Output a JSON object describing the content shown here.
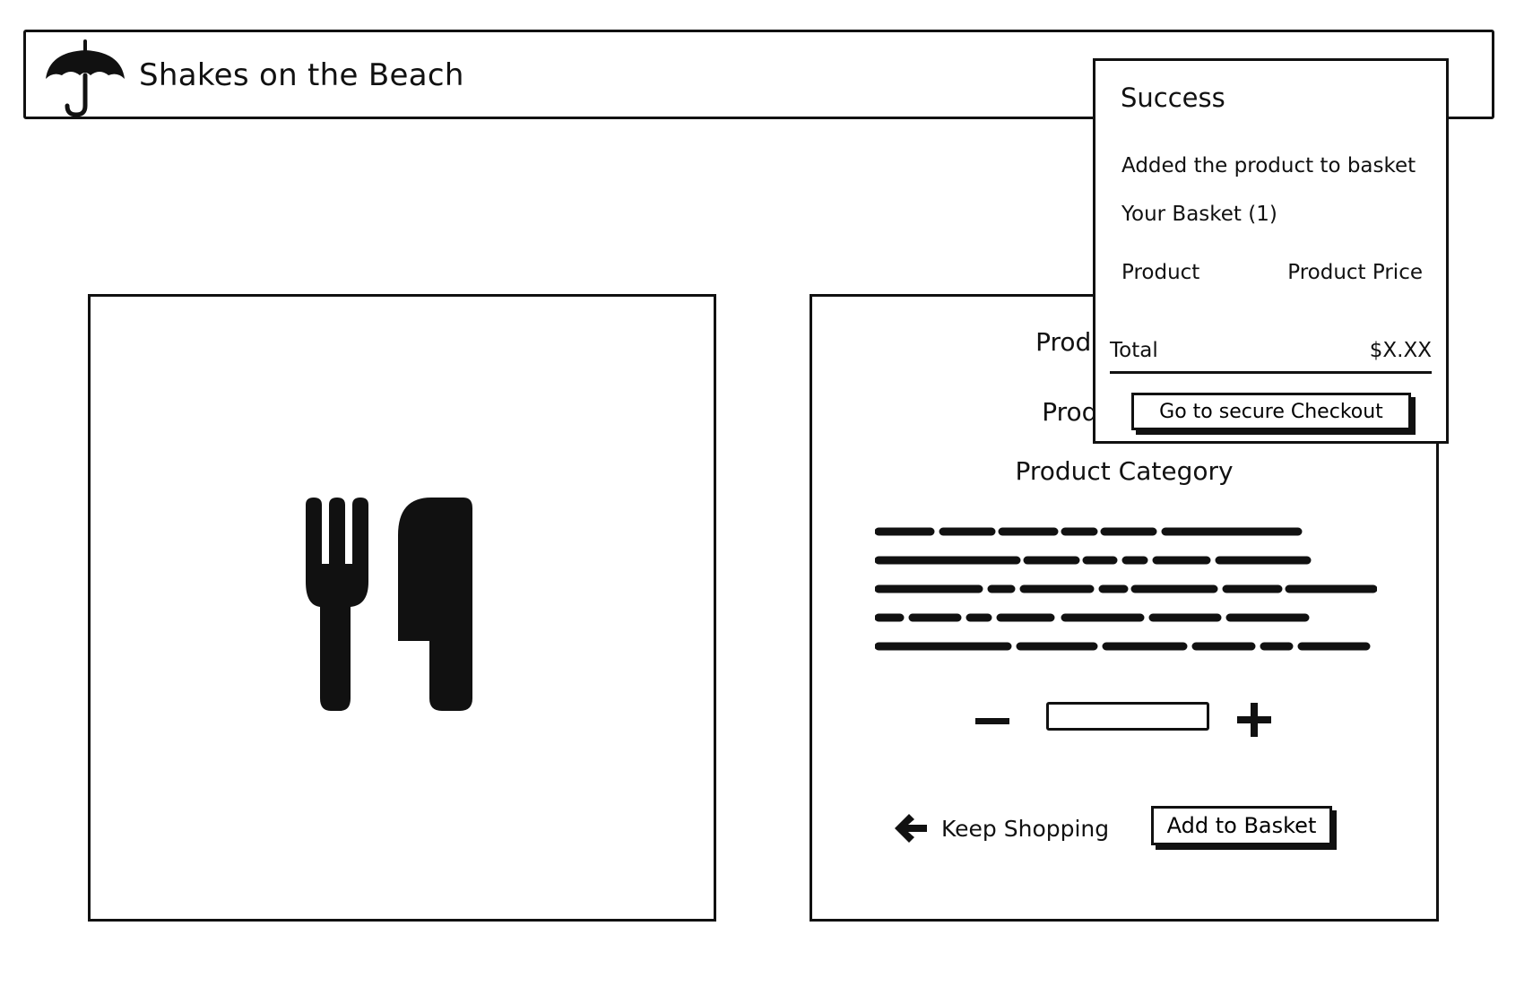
{
  "header": {
    "logo_icon": "umbrella-icon",
    "title": "Shakes on the Beach"
  },
  "image_panel": {
    "icon": "fork-knife-icon"
  },
  "product": {
    "name": "Product Name",
    "price": "Product Price",
    "category": "Product Category",
    "description_lines": 5
  },
  "quantity": {
    "minus_icon": "minus-icon",
    "value": "",
    "plus_icon": "plus-icon"
  },
  "actions": {
    "keep_shopping_label": "Keep Shopping",
    "keep_shopping_icon": "arrow-left-icon",
    "add_to_basket_label": "Add to Basket"
  },
  "popup": {
    "title": "Success",
    "message": "Added the product to basket",
    "basket_title": "Your Basket (1)",
    "columns": [
      "Product",
      "Product Price"
    ],
    "total_label": "Total",
    "total_value": "$X.XX",
    "checkout_label": "Go to secure Checkout"
  }
}
